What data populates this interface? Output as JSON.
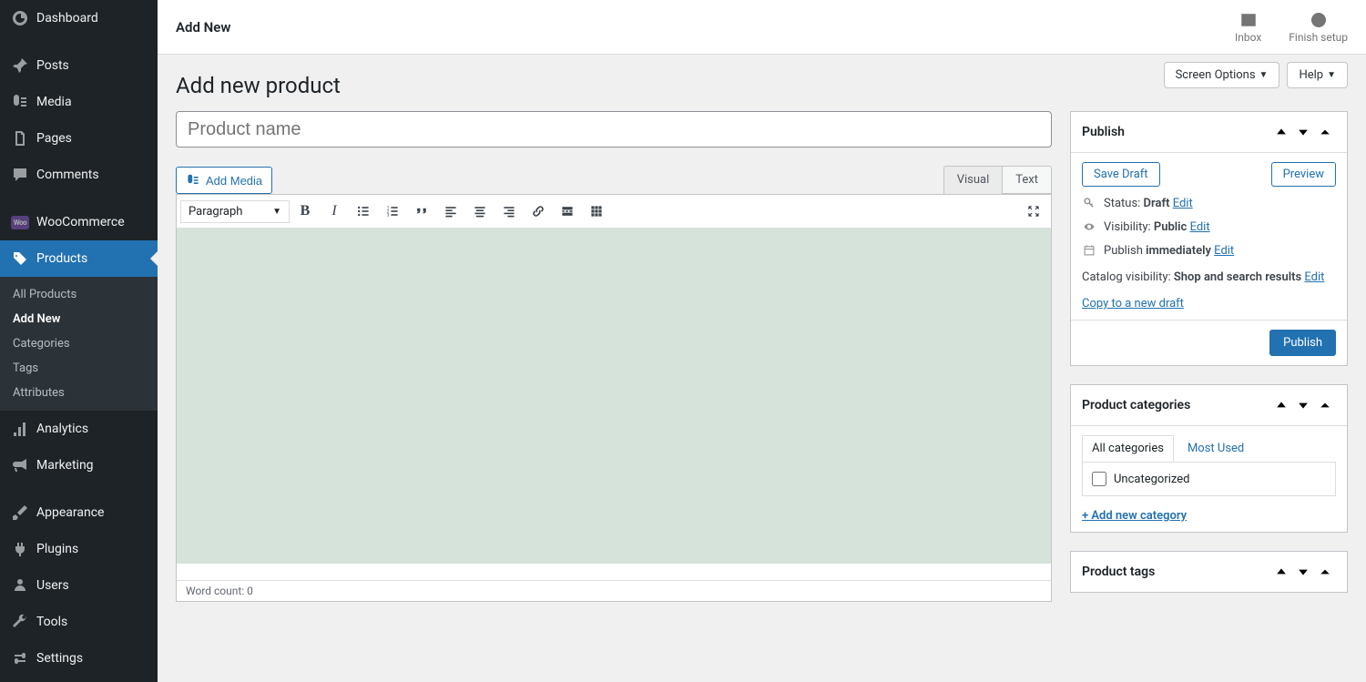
{
  "topbar": {
    "title": "Add New",
    "inbox": "Inbox",
    "finish_setup": "Finish setup"
  },
  "sidebar": {
    "dashboard": "Dashboard",
    "posts": "Posts",
    "media": "Media",
    "pages": "Pages",
    "comments": "Comments",
    "woocommerce": "WooCommerce",
    "products": "Products",
    "analytics": "Analytics",
    "marketing": "Marketing",
    "appearance": "Appearance",
    "plugins": "Plugins",
    "users": "Users",
    "tools": "Tools",
    "settings": "Settings",
    "products_sub": {
      "all": "All Products",
      "add_new": "Add New",
      "categories": "Categories",
      "tags": "Tags",
      "attributes": "Attributes"
    }
  },
  "page": {
    "heading": "Add new product",
    "title_placeholder": "Product name",
    "screen_options": "Screen Options",
    "help": "Help"
  },
  "editor": {
    "add_media": "Add Media",
    "tab_visual": "Visual",
    "tab_text": "Text",
    "paragraph": "Paragraph",
    "word_count": "Word count: 0"
  },
  "publish": {
    "title": "Publish",
    "save_draft": "Save Draft",
    "preview": "Preview",
    "status_label": "Status: ",
    "status_value": "Draft",
    "visibility_label": "Visibility: ",
    "visibility_value": "Public",
    "publish_label": "Publish ",
    "publish_value": "immediately",
    "catalog_label": "Catalog visibility: ",
    "catalog_value": "Shop and search results",
    "edit": "Edit",
    "copy": "Copy to a new draft",
    "publish_btn": "Publish"
  },
  "categories": {
    "title": "Product categories",
    "tab_all": "All categories",
    "tab_most": "Most Used",
    "uncat": "Uncategorized",
    "add_new": "+ Add new category"
  },
  "tags": {
    "title": "Product tags"
  }
}
